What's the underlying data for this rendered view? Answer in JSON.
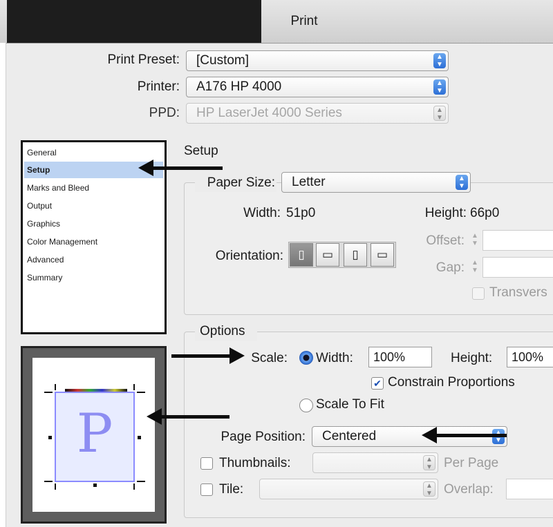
{
  "window": {
    "title": "Print"
  },
  "top": {
    "print_preset": {
      "label": "Print Preset:",
      "value": "[Custom]"
    },
    "printer": {
      "label": "Printer:",
      "value": "A176 HP 4000"
    },
    "ppd": {
      "label": "PPD:",
      "value": "HP LaserJet 4000 Series"
    }
  },
  "sidebar": {
    "items": [
      {
        "label": "General"
      },
      {
        "label": "Setup",
        "selected": true
      },
      {
        "label": "Marks and Bleed"
      },
      {
        "label": "Output"
      },
      {
        "label": "Graphics"
      },
      {
        "label": "Color Management"
      },
      {
        "label": "Advanced"
      },
      {
        "label": "Summary"
      }
    ]
  },
  "preview": {
    "glyph": "P"
  },
  "setup": {
    "heading": "Setup",
    "paper_size": {
      "label": "Paper Size:",
      "value": "Letter"
    },
    "width": {
      "label": "Width:",
      "value": "51p0"
    },
    "height": {
      "label": "Height:",
      "value": "66p0"
    },
    "orientation": {
      "label": "Orientation:"
    },
    "offset": {
      "label": "Offset:",
      "value": ""
    },
    "gap": {
      "label": "Gap:",
      "value": ""
    },
    "transverse": {
      "label": "Transvers",
      "checked": false
    }
  },
  "options": {
    "heading": "Options",
    "scale_label": "Scale:",
    "width_label": "Width:",
    "width_value": "100%",
    "height_label": "Height:",
    "height_value": "100%",
    "constrain": {
      "label": "Constrain Proportions",
      "checked": true
    },
    "scale_to_fit": {
      "label": "Scale To Fit",
      "selected": false
    },
    "page_position": {
      "label": "Page Position:",
      "value": "Centered"
    },
    "thumbnails": {
      "label": "Thumbnails:",
      "value": "",
      "suffix": "Per Page",
      "checked": false
    },
    "tile": {
      "label": "Tile:",
      "value": "",
      "suffix": "Overlap:",
      "checked": false
    }
  },
  "colors": {
    "selection": "#bcd3f2",
    "accent": "#2d6fd6",
    "arrow": "#0d0d0d"
  }
}
